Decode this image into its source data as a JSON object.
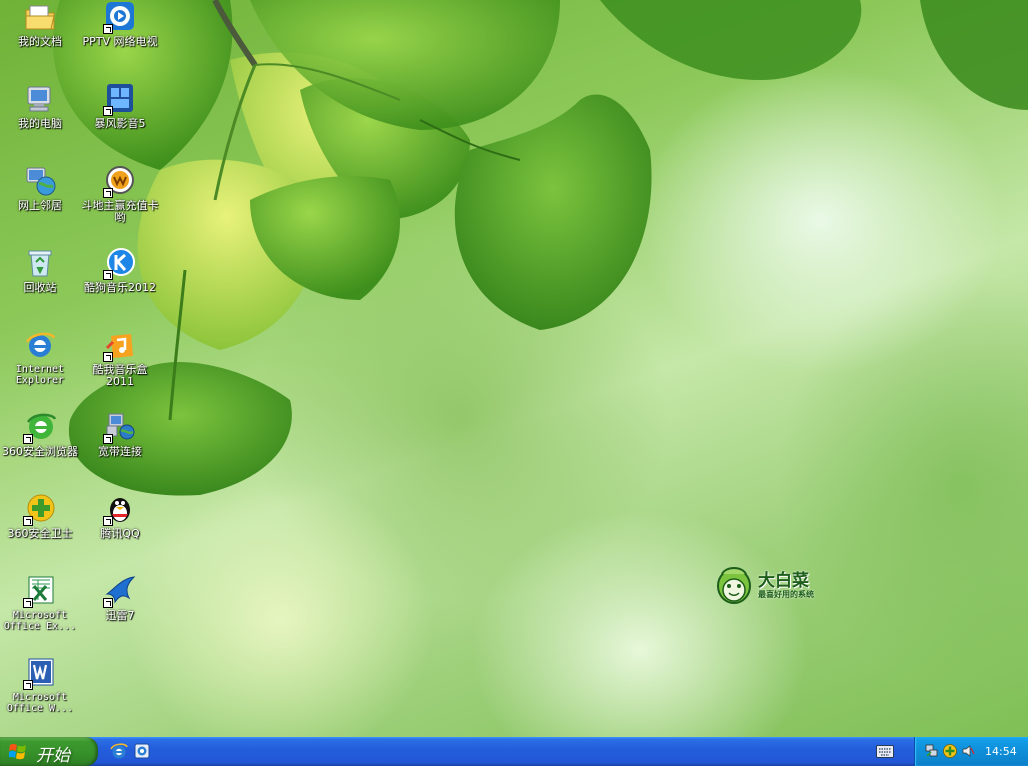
{
  "desktop": {
    "icons": [
      {
        "label": "我的文档"
      },
      {
        "label": "PPTV 网络电视"
      },
      {
        "label": "我的电脑"
      },
      {
        "label": "暴风影音5"
      },
      {
        "label": "网上邻居"
      },
      {
        "label": "斗地主赢充值卡哟"
      },
      {
        "label": "回收站"
      },
      {
        "label": "酷狗音乐2012"
      },
      {
        "label": "Internet Explorer"
      },
      {
        "label": "酷我音乐盒2011"
      },
      {
        "label": "360安全浏览器"
      },
      {
        "label": "宽带连接"
      },
      {
        "label": "360安全卫士"
      },
      {
        "label": "腾讯QQ"
      },
      {
        "label": "Microsoft Office Ex..."
      },
      {
        "label": "迅雷7"
      },
      {
        "label": "Microsoft Office W..."
      }
    ]
  },
  "brand": {
    "title": "大白菜",
    "subtitle": "最喜好用的系统"
  },
  "taskbar": {
    "start_label": "开始",
    "clock": "14:54"
  },
  "colors": {
    "taskbar_blue": "#245edb",
    "start_green": "#36902a",
    "tray_blue": "#0f8ed8"
  }
}
